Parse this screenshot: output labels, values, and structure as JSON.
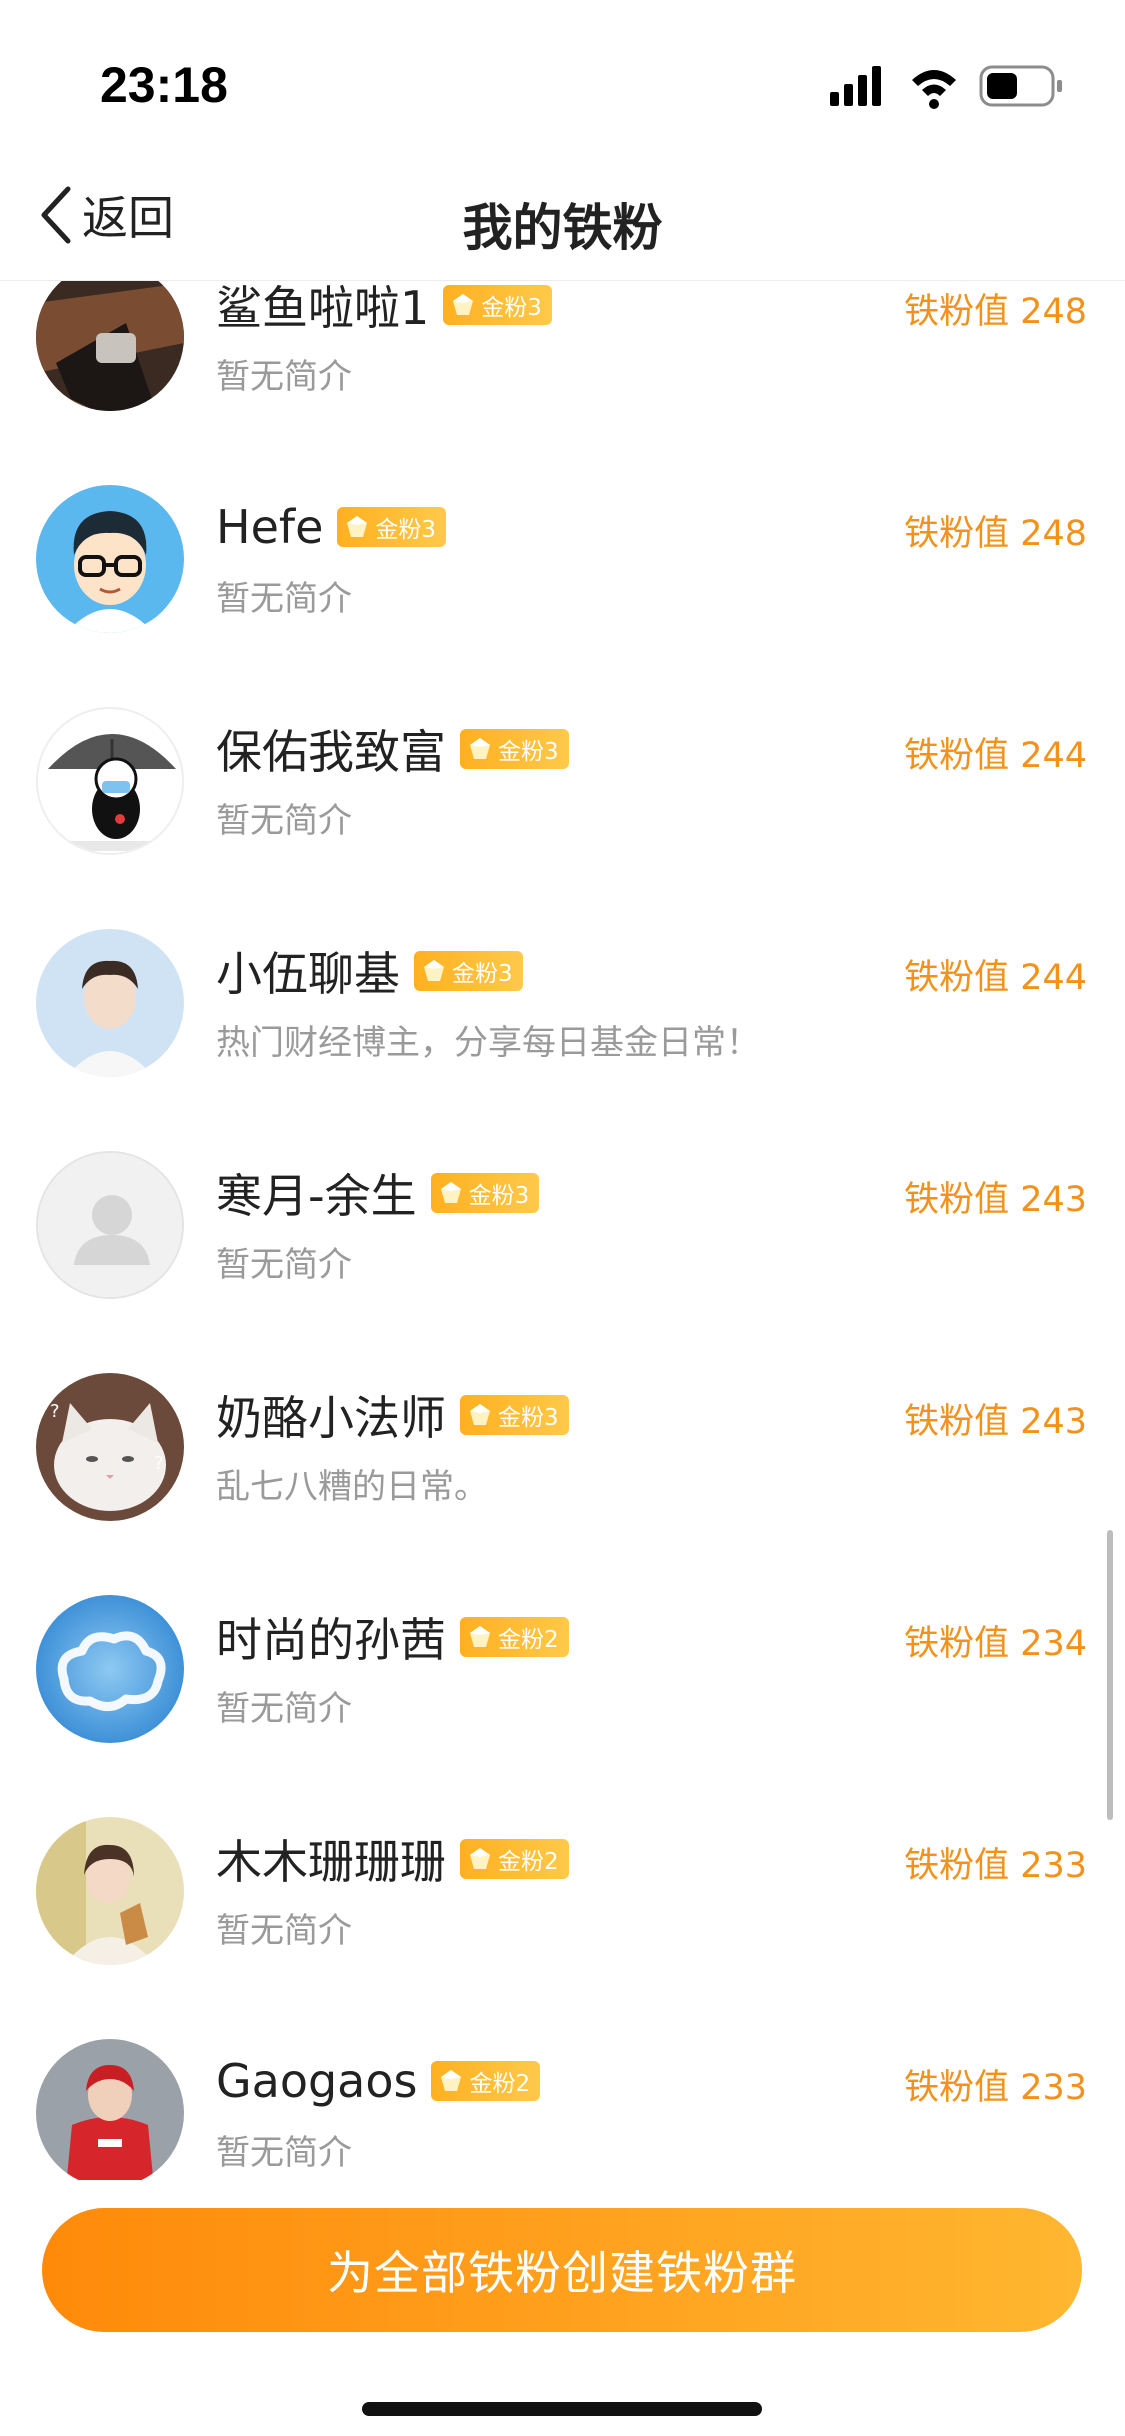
{
  "status_bar": {
    "time": "23:18"
  },
  "nav": {
    "back_label": "返回",
    "title": "我的铁粉"
  },
  "fans": [
    {
      "name": "鲨鱼啦啦1",
      "badge": "金粉3",
      "bio": "暂无简介",
      "value_label": "铁粉值 248",
      "avatar": "car-interior"
    },
    {
      "name": "Hefe",
      "badge": "金粉3",
      "bio": "暂无简介",
      "value_label": "铁粉值 248",
      "avatar": "cartoon-man"
    },
    {
      "name": "保佑我致富",
      "badge": "金粉3",
      "bio": "暂无简介",
      "value_label": "铁粉值 244",
      "avatar": "panda-umbrella"
    },
    {
      "name": "小伍聊基",
      "badge": "金粉3",
      "bio": "热门财经博主，分享每日基金日常！",
      "value_label": "铁粉值 244",
      "avatar": "young-man"
    },
    {
      "name": "寒月-余生",
      "badge": "金粉3",
      "bio": "暂无简介",
      "value_label": "铁粉值 243",
      "avatar": "default-person"
    },
    {
      "name": "奶酪小法师",
      "badge": "金粉3",
      "bio": "乱七八糟的日常。",
      "value_label": "铁粉值 243",
      "avatar": "white-cat"
    },
    {
      "name": "时尚的孙茜",
      "badge": "金粉2",
      "bio": "暂无简介",
      "value_label": "铁粉值 234",
      "avatar": "cloud-sky"
    },
    {
      "name": "木木珊珊珊",
      "badge": "金粉2",
      "bio": "暂无简介",
      "value_label": "铁粉值 233",
      "avatar": "girl-bread"
    },
    {
      "name": "Gaogaos",
      "badge": "金粉2",
      "bio": "暂无简介",
      "value_label": "铁粉值 233",
      "avatar": "racer-red"
    }
  ],
  "bottom": {
    "button_label": "为全部铁粉创建铁粉群"
  },
  "colors": {
    "accent": "#f2921b",
    "button_start": "#ff8a0a",
    "button_end": "#ffb630",
    "badge": "#ffb020"
  }
}
